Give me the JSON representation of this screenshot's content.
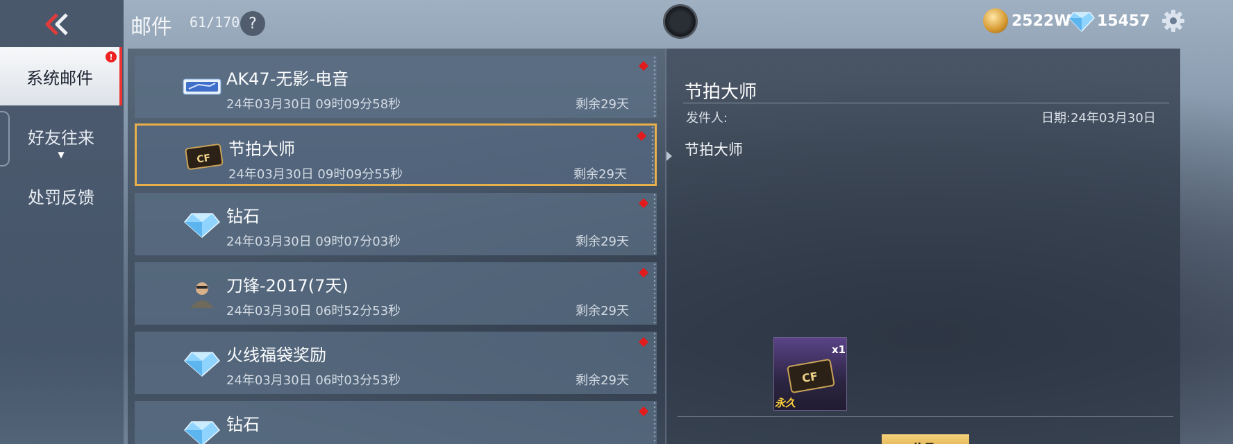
{
  "nav": {
    "tabs": [
      {
        "label": "系统邮件",
        "active": true,
        "badge": "!"
      },
      {
        "label": "好友往来",
        "active": false,
        "has_dropdown": true
      },
      {
        "label": "处罚反馈",
        "active": false
      }
    ]
  },
  "header": {
    "title": "邮件",
    "mail_count": "61/170",
    "help_label": "?",
    "gold": {
      "value": "2522W",
      "icon": "gold-coin-icon"
    },
    "diamonds": {
      "value": "15457",
      "icon": "diamond-icon"
    }
  },
  "mail_list": [
    {
      "title": "AK47-无影-电音",
      "date": "24年03月30日 09时09分58秒",
      "remaining": "剩余29天",
      "icon": "weapon-card-icon",
      "unread": true,
      "selected": false
    },
    {
      "title": "节拍大师",
      "date": "24年03月30日 09时09分55秒",
      "remaining": "剩余29天",
      "icon": "cf-badge-icon",
      "unread": true,
      "selected": true
    },
    {
      "title": "钻石",
      "date": "24年03月30日 09时07分03秒",
      "remaining": "剩余29天",
      "icon": "diamond-icon",
      "unread": true,
      "selected": false
    },
    {
      "title": "刀锋-2017(7天)",
      "date": "24年03月30日 06时52分53秒",
      "remaining": "剩余29天",
      "icon": "character-icon",
      "unread": true,
      "selected": false
    },
    {
      "title": "火线福袋奖励",
      "date": "24年03月30日 06时03分53秒",
      "remaining": "剩余29天",
      "icon": "diamond-icon",
      "unread": true,
      "selected": false
    },
    {
      "title": "钻石",
      "date": "",
      "remaining": "",
      "icon": "diamond-icon",
      "unread": true,
      "selected": false
    }
  ],
  "detail": {
    "title": "节拍大师",
    "sender_label": "发件人:",
    "date_label": "日期:24年03月30日",
    "body": "节拍大师",
    "attachment": {
      "count": "x1",
      "tag": "永久",
      "icon": "cf-badge-icon"
    },
    "claim_label": "收取"
  },
  "colors": {
    "selected_border": "#e8b04b",
    "unread_dot": "#e21c1c",
    "claim_button": "#e7bb5a",
    "active_tab_bg": "#eef1f5"
  }
}
